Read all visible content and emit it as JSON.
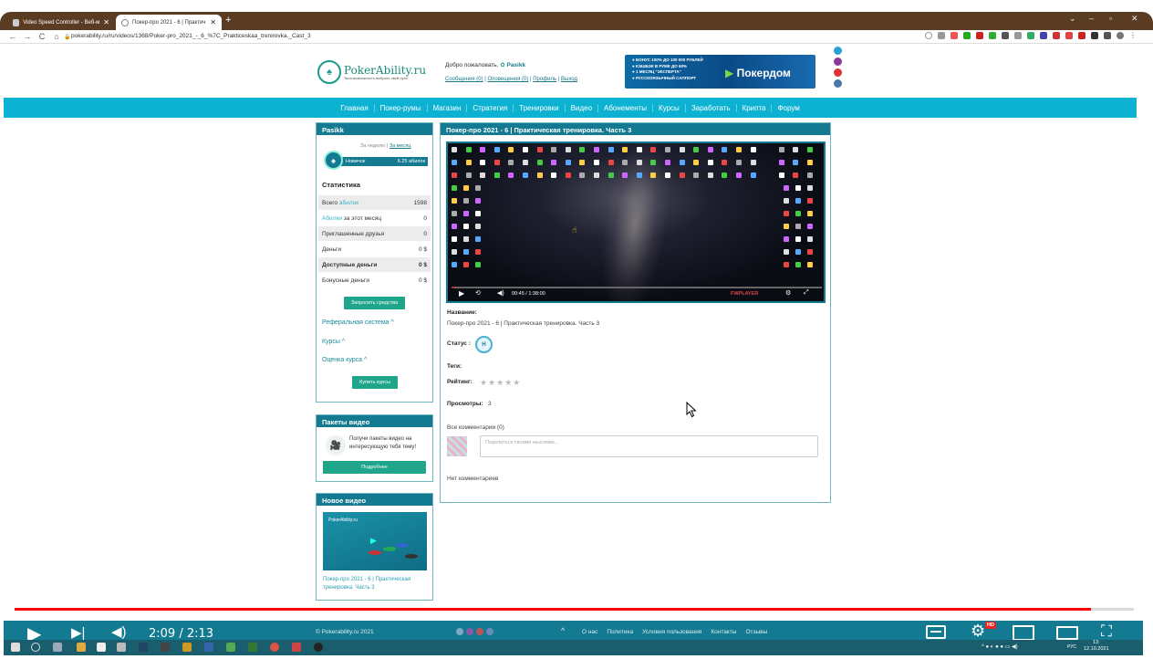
{
  "browser": {
    "tabs": [
      {
        "title": "Video Speed Controller - Веб-м",
        "active": false
      },
      {
        "title": "Покер-про 2021 - 6 | Практич",
        "active": true
      }
    ],
    "new_tab_label": "+",
    "window_controls": [
      "⌄",
      "–",
      "▫",
      "✕"
    ],
    "nav_buttons": [
      "←",
      "→",
      "C",
      "⌂"
    ],
    "url": "pokerability.ru/ru/videos/1368/Poker-pro_2021_-_6_%7C_Prakticeskaa_trenirovka._Cast_3"
  },
  "site": {
    "logo_title": "PokerAbility.ru",
    "logo_subtitle": "Твоя возможность выбрать свой путь!",
    "welcome_prefix": "Добро пожаловать,",
    "username": "Pasikk",
    "user_menu": [
      "Сообщения (0)",
      "Оповещения (0)",
      "Профиль",
      "Выход"
    ],
    "banner": {
      "lines": [
        "БОНУС 100% ДО 100 000 РУБЛЕЙ",
        "КЭШБЭК В РУМЕ ДО 60%",
        "1 МЕСЯЦ \"ЭКСПЕРТА\"",
        "РУССКОЯЗЫЧНЫЙ САППОРТ"
      ],
      "brand": "Покердом"
    },
    "nav": [
      "Главная",
      "Покер-румы",
      "Магазин",
      "Стратегия",
      "Тренировки",
      "Видео",
      "Абонементы",
      "Курсы",
      "Заработать",
      "Крипта",
      "Форум"
    ]
  },
  "sidebar": {
    "user_panel": {
      "title": "Pasikk",
      "period_links": [
        "За неделю",
        "За месяц"
      ],
      "rank": "Новичок",
      "rank_points": "6.25 абилок",
      "stats_title": "Статистика",
      "stats": [
        {
          "pre": "Всего ",
          "hl": "абилок",
          "post": "",
          "value": "1598",
          "bold": false
        },
        {
          "pre": "",
          "hl": "Абилки",
          "post": " за этот месяц",
          "value": "0",
          "bold": false
        },
        {
          "pre": "Приглашенные друзья",
          "hl": "",
          "post": "",
          "value": "0",
          "bold": false
        },
        {
          "pre": "Деньги",
          "hl": "",
          "post": "",
          "value": "0 $",
          "bold": false
        },
        {
          "pre": "Доступные деньги",
          "hl": "",
          "post": "",
          "value": "0 $",
          "bold": true
        },
        {
          "pre": "Бонусные деньги",
          "hl": "",
          "post": "",
          "value": "0 $",
          "bold": false
        }
      ],
      "request_button": "Запросить средства",
      "accordions": [
        "Реферальная система ^",
        "Курсы ^",
        "Оценка курса ^"
      ],
      "buy_button": "Купить курсы"
    },
    "packs_panel": {
      "title": "Пакеты видео",
      "text": "Получи пакеты видео на интересующую тебя тему!",
      "button": "Подробнее"
    },
    "new_video_panel": {
      "title": "Новое видео",
      "thumb_logo": "PokerAbility.ru",
      "caption": "Покер-про 2021 - 6 | Практическая тренировка. Часть 3"
    }
  },
  "content": {
    "title": "Покер-про 2021 - 6 | Практическая тренировка. Часть 3",
    "player": {
      "time": "00:45 / 1:38:00",
      "brand": "FWPLAYER",
      "progress": 0.008
    },
    "name_label": "Название:",
    "name_value": "Покер-про 2021 - 6 | Практическая тренировка. Часть 3",
    "status_label": "Статус :",
    "status_badge": "H",
    "tags_label": "Теги:",
    "rating_label": "Рейтинг:",
    "rating_stars": "★★★★★",
    "rating_value": 0,
    "views_label": "Просмотры:",
    "views_value": "3",
    "comments_header": "Все комментарии (0)",
    "comment_placeholder": "Поделиться своими мыслями...",
    "no_comments": "Нет комментариев"
  },
  "footer": {
    "copyright": "© Pokerability.ru 2021",
    "links": [
      "О нас",
      "Политика",
      "Условия пользования",
      "Контакты",
      "Отзывы"
    ]
  },
  "youtube": {
    "time": "2:09 / 2:13",
    "progress": 0.962,
    "hd_badge": "HD"
  },
  "taskbar": {
    "lang": "РУС",
    "clock_time": "13:",
    "clock_date": "12.10.2021"
  }
}
